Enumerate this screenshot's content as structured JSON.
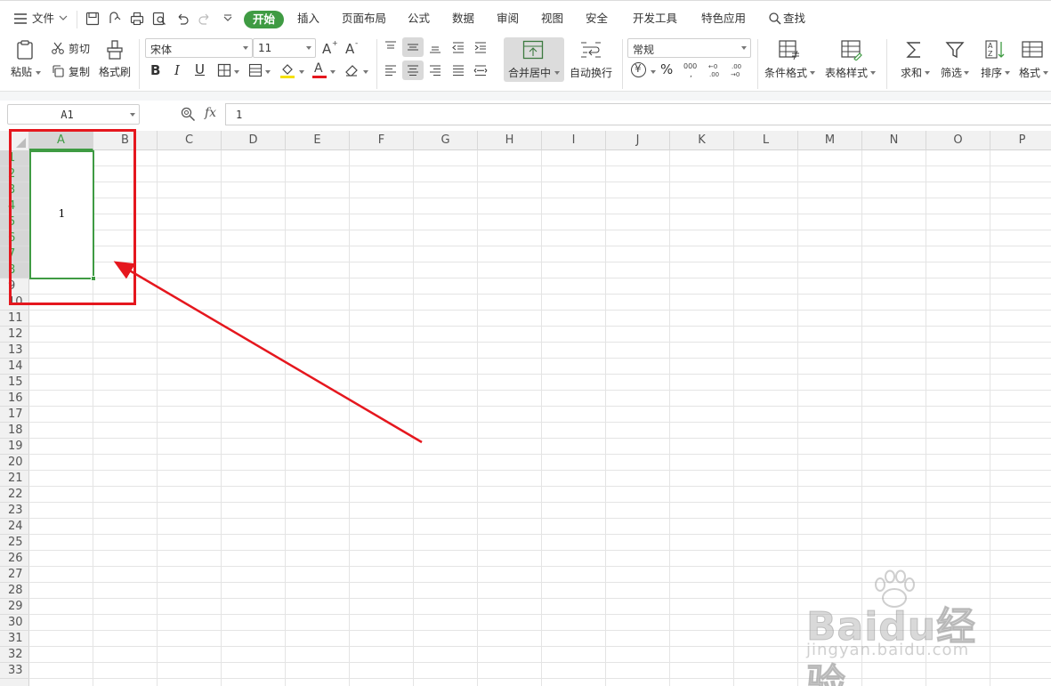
{
  "menubar": {
    "file_label": "文件",
    "tabs": [
      {
        "label": "开始"
      },
      {
        "label": "插入"
      },
      {
        "label": "页面布局"
      },
      {
        "label": "公式"
      },
      {
        "label": "数据"
      },
      {
        "label": "审阅"
      },
      {
        "label": "视图"
      },
      {
        "label": "安全"
      },
      {
        "label": "开发工具"
      },
      {
        "label": "特色应用"
      }
    ],
    "search_label": "查找",
    "active_tab": "开始"
  },
  "ribbon": {
    "paste_label": "粘贴",
    "cut_label": "剪切",
    "copy_label": "复制",
    "format_painter_label": "格式刷",
    "font_name": "宋体",
    "font_size": "11",
    "bold_glyph": "B",
    "italic_glyph": "I",
    "underline_glyph": "U",
    "font_color_glyph": "A",
    "merge_label": "合并居中",
    "wrap_label": "自动换行",
    "number_format": "常规",
    "currency_glyph": "¥",
    "percent_glyph": "%",
    "thousands_glyph": "000",
    "conditional_format_label": "条件格式",
    "table_style_label": "表格样式",
    "sum_label": "求和",
    "filter_label": "筛选",
    "sort_label": "排序",
    "format_label": "格式",
    "colors": {
      "accent": "#3f9b43",
      "font_color_bar": "#e5171e",
      "fill_color_bar": "#f5e000"
    }
  },
  "formula_bar": {
    "name_box": "A1",
    "fx_label": "fx",
    "formula_value": "1"
  },
  "sheet": {
    "columns": [
      "A",
      "B",
      "C",
      "D",
      "E",
      "F",
      "G",
      "H",
      "I",
      "J",
      "K",
      "L",
      "M",
      "N",
      "O",
      "P"
    ],
    "rows": [
      "1",
      "2",
      "3",
      "4",
      "5",
      "6",
      "7",
      "8",
      "9",
      "10",
      "11",
      "12",
      "13",
      "14",
      "15",
      "16",
      "17",
      "18",
      "19",
      "20",
      "21",
      "22",
      "23",
      "24",
      "25",
      "26",
      "27",
      "28",
      "29",
      "30",
      "31",
      "32",
      "33"
    ],
    "active_column": "A",
    "merged_cell": {
      "range": "A1:A8",
      "value": "1"
    }
  },
  "annotation": {
    "color": "#e5171e"
  },
  "watermark": {
    "brand": "Baidu经验",
    "url": "jingyan.baidu.com"
  }
}
